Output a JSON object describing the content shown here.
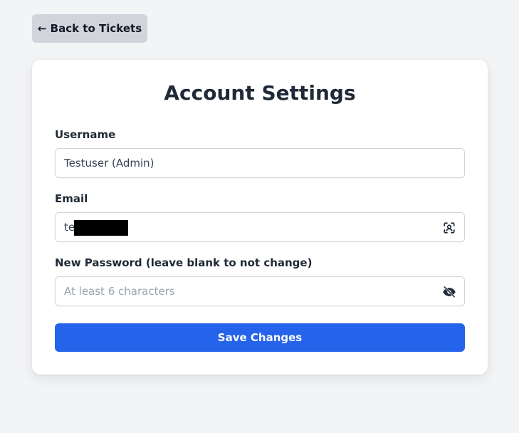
{
  "header": {
    "back_label": "← Back to Tickets"
  },
  "form": {
    "title": "Account Settings",
    "username": {
      "label": "Username",
      "value": "Testuser (Admin)"
    },
    "email": {
      "label": "Email",
      "value": "te",
      "icon": "person-scan-icon"
    },
    "password": {
      "label": "New Password (leave blank to not change)",
      "placeholder": "At least 6 characters",
      "value": "",
      "icon": "eye-off-icon"
    },
    "save_label": "Save Changes"
  },
  "colors": {
    "background": "#f3f4f6",
    "back_button": "#d1d5db",
    "primary": "#2563eb",
    "card": "#ffffff"
  }
}
